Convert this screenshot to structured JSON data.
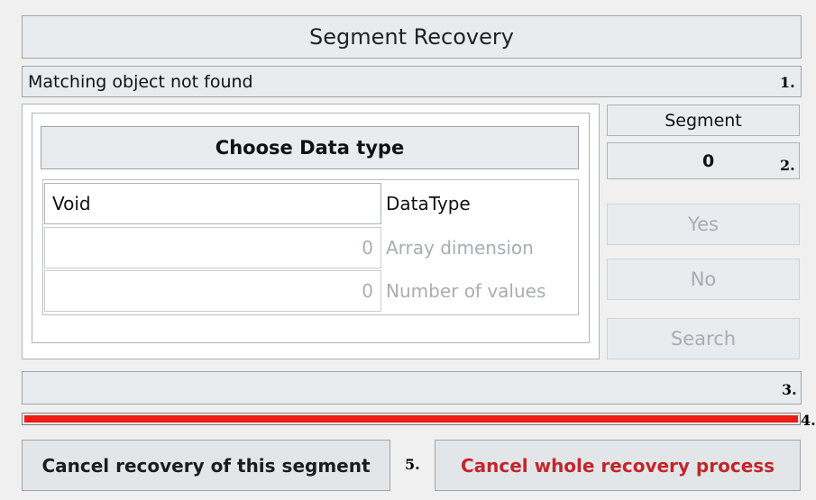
{
  "window": {
    "title": "Segment Recovery"
  },
  "status": {
    "message": "Matching object not found",
    "marker": "1."
  },
  "data_type_panel": {
    "header": "Choose Data type",
    "rows": [
      {
        "value": "Void",
        "label": "DataType",
        "muted": false
      },
      {
        "value": "0",
        "label": "Array dimension",
        "muted": true
      },
      {
        "value": "0",
        "label": "Number of values",
        "muted": true
      }
    ]
  },
  "segment": {
    "label": "Segment",
    "value": "0",
    "marker": "2."
  },
  "buttons": {
    "yes": "Yes",
    "no": "No",
    "search": "Search"
  },
  "info_bar": {
    "text": "",
    "marker": "3."
  },
  "progress": {
    "percent": 100,
    "marker": "4.",
    "color": "#ef1b14"
  },
  "footer": {
    "cancel_segment": "Cancel recovery of this segment",
    "marker": "5.",
    "cancel_all": "Cancel whole recovery process",
    "cancel_all_color": "#c2262a"
  }
}
